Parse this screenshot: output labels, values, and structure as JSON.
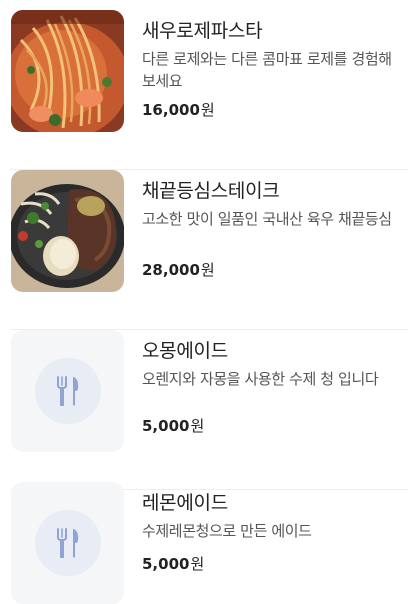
{
  "menu": [
    {
      "name": "새우로제파스타",
      "description": "다른 로제와는 다른 콤마표 로제를 경험해보세요",
      "price": "16,000",
      "currency": "원",
      "photo": "pasta-photo"
    },
    {
      "name": "채끝등심스테이크",
      "description": "고소한 맛이 일품인 국내산 육우 채끝등심",
      "price": "28,000",
      "currency": "원",
      "photo": "steak-photo"
    },
    {
      "name": "오몽에이드",
      "description": "오렌지와 자몽을 사용한 수제 청 입니다",
      "price": "5,000",
      "currency": "원",
      "photo": "utensils-icon"
    },
    {
      "name": "레몬에이드",
      "description": "수제레몬청으로 만든 에이드",
      "price": "5,000",
      "currency": "원",
      "photo": "utensils-icon"
    }
  ],
  "colors": {
    "placeholder_bg": "#f5f6f8",
    "placeholder_circle": "#e8ecf4",
    "icon": "#8fa4d4"
  }
}
